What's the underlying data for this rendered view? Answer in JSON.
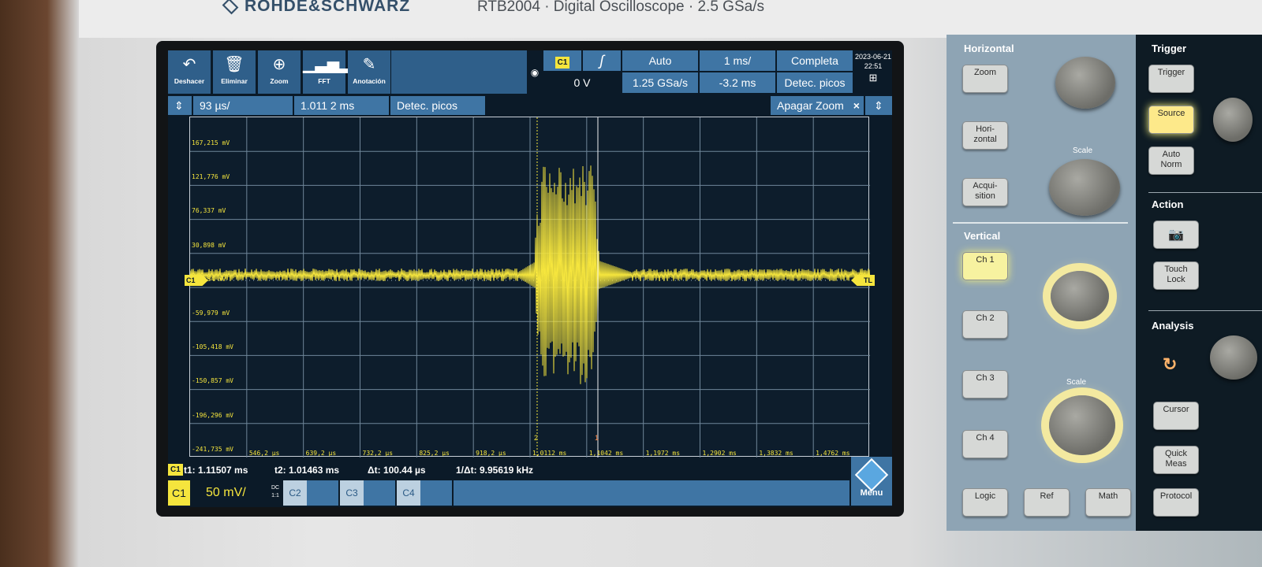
{
  "instrument": {
    "brand": "ROHDE&SCHWARZ",
    "model_line": "RTB2004 · Digital Oscilloscope · 2.5 GSa/s"
  },
  "toolbar": {
    "tools": [
      {
        "label": "Deshacer",
        "icon": "undo-icon"
      },
      {
        "label": "Eliminar",
        "icon": "trash-icon"
      },
      {
        "label": "Zoom",
        "icon": "magnifier-icon"
      },
      {
        "label": "FFT",
        "icon": "spectrum-icon"
      },
      {
        "label": "Anotación",
        "icon": "pencil-icon"
      }
    ],
    "trigger_source": "C1",
    "trigger_level": "0 V",
    "edge_symbol": "ʃ",
    "trigger_mode": "Auto",
    "sample_rate": "1.25 GSa/s",
    "time_scale": "1 ms/",
    "time_offset": "-3.2 ms",
    "acq_state": "Completa",
    "acq_mode": "Detec. picos",
    "date": "2023-06-21",
    "time": "22:51"
  },
  "zoom": {
    "scale": "93 µs/",
    "position": "1.011 2 ms",
    "mode": "Detec. picos",
    "off_label": "Apagar Zoom",
    "close_glyph": "×"
  },
  "graticule": {
    "y_labels": [
      "167,215 mV",
      "121,776 mV",
      "76,337 mV",
      "30,898 mV",
      "-14,54 mV",
      "-59,979 mV",
      "-105,418 mV",
      "-150,857 mV",
      "-196,296 mV",
      "-241,735 mV"
    ],
    "x_labels": [
      "546,2 µs",
      "639,2 µs",
      "732,2 µs",
      "825,2 µs",
      "918,2 µs",
      "1,0112 ms",
      "1,1042 ms",
      "1,1972 ms",
      "1,2902 ms",
      "1,3832 ms",
      "1,4762 ms"
    ],
    "channel_marker": "C1",
    "trigger_marker": "TL",
    "cursor_labels": [
      "2",
      "1"
    ],
    "trace_color": "#f5e53d"
  },
  "cursors": {
    "chip": "C1",
    "t1": "t1: 1.11507 ms",
    "t2": "t2: 1.01463 ms",
    "dt": "Δt: 100.44 µs",
    "inv_dt": "1/Δt: 9.95619 kHz"
  },
  "channels": {
    "c1": {
      "label": "C1",
      "scale": "50 mV/",
      "coupling": "DC",
      "impedance": "1:1"
    },
    "c2": {
      "label": "C2"
    },
    "c3": {
      "label": "C3"
    },
    "c4": {
      "label": "C4"
    },
    "menu_label": "Menu"
  },
  "panel": {
    "horizontal": {
      "title": "Horizontal",
      "buttons": [
        "Zoom",
        "Hori-\nzontal",
        "Acqui-\nsition"
      ],
      "knob_label": "Scale"
    },
    "vertical": {
      "title": "Vertical",
      "buttons": [
        "Ch 1",
        "Ch 2",
        "Ch 3",
        "Ch 4"
      ],
      "knob_label": "Scale"
    },
    "bottom": [
      "Logic",
      "Ref",
      "Math",
      "Protocol"
    ],
    "trigger": {
      "title": "Trigger",
      "buttons": [
        "Trigger",
        "Source",
        "Auto\nNorm"
      ]
    },
    "action": {
      "title": "Action",
      "buttons": [
        "Touch\nLock"
      ]
    },
    "analysis": {
      "title": "Analysis",
      "buttons": [
        "Cursor",
        "Quick\nMeas"
      ]
    }
  }
}
